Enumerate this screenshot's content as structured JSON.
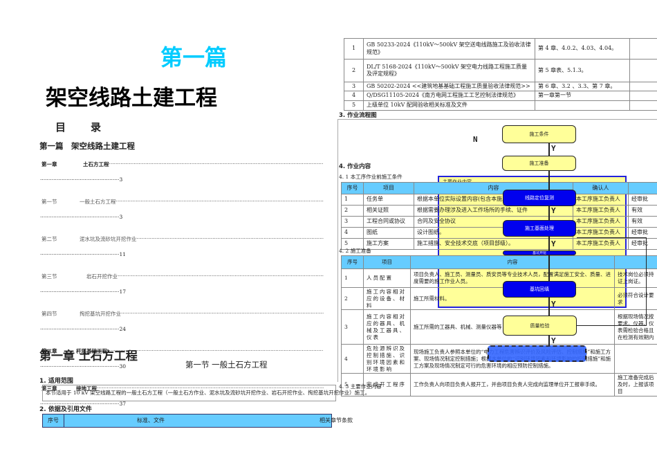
{
  "part": {
    "label": "第一篇",
    "title": "架空线路土建工程"
  },
  "toc": {
    "title": "目　　录",
    "part_heading": "第一篇　架空线路土建工程",
    "entries": [
      {
        "num": "第一章",
        "title": "土石方工程",
        "page": "3",
        "bold": true
      },
      {
        "num": "第一节",
        "title": "一般土石方工程",
        "page": "3",
        "bold": false
      },
      {
        "num": "第二节",
        "title": "泥水坑及流砂坑开挖作业",
        "page": "11",
        "bold": false
      },
      {
        "num": "第三节",
        "title": "岩石开挖作业",
        "page": "17",
        "bold": false
      },
      {
        "num": "第四节",
        "title": "掏挖基坑开挖作业",
        "page": "24",
        "bold": false
      },
      {
        "num": "第二章",
        "title": "杆塔基础工程",
        "page": "30",
        "bold": true
      },
      {
        "num": "第三章",
        "title": "接地工程",
        "page": "37",
        "bold": true
      }
    ]
  },
  "chapter": {
    "title": "第一章 土石方工程",
    "section": "第一节 一般土石方工程"
  },
  "scope": {
    "heading": "1. 适用范围",
    "text": "本节适用于 10 kV 架空线路工程的一般土石方工程（一般土石方作业、泥水坑及流砂坑开挖作业、岩石开挖作业、掏挖基坑开挖作业）施工。"
  },
  "refs": {
    "heading": "2. 依据及引用文件",
    "headers": [
      "序号",
      "标准、文件",
      "相关章节条款"
    ],
    "rows": [
      [
        "1",
        "GB 50233-2024《110kV～500kV 架空送电线路施工及验收法律规范》",
        "第 4 章、4.0.2、4.03、4.04。"
      ],
      [
        "2",
        "DL/T 5168-2024《110kV～500kV 架空电力线路工程施工质量及评定规程》",
        "第 5 章表、5.1.3。"
      ],
      [
        "3",
        "GB 50202-2024 <<建筑地基基础工程施工质量验收法律规范>>",
        "第 6 章、3.2 、3.3、第 7 章。"
      ],
      [
        "4",
        "Q/DSG11105-2024《南方电网工程施工工艺控制法律规范》",
        "第一章第一节"
      ],
      [
        "5",
        "上级单位 10kV 配网验收相关标准及文件",
        ""
      ]
    ]
  },
  "flow": {
    "heading": "3. 作业流程图",
    "n_label": "N",
    "y_label": "Y",
    "main_label": "主要作业内容",
    "steps": [
      "施工条件",
      "施工准备",
      "线路定位复测",
      "施工基面处理",
      "基坑开挖",
      "基坑回填",
      "质量检验"
    ]
  },
  "work": {
    "heading": "4. 作业内容",
    "cond": {
      "heading": "4. 1 本工序作业前施工条件",
      "headers": [
        "序号",
        "项目",
        "内容",
        "确认人",
        ""
      ],
      "rows": [
        [
          "1",
          "任务单",
          "根据本单位实际设置内容(包含本施工作业任务)",
          "本工序施工负责人",
          "经审批"
        ],
        [
          "2",
          "相关证照",
          "根据需要办理涉及进入工作场所的手续、证件",
          "本工序施工负责人",
          "有效"
        ],
        [
          "3",
          "工程合同或协议",
          "合同及安全协议",
          "本工序施工负责人",
          "有效"
        ],
        [
          "4",
          "图纸",
          "设计图纸。",
          "本工序施工负责人",
          "经审批"
        ],
        [
          "5",
          "施工方案",
          "施工措施、安全技术交底（项目部级）。",
          "本工序施工负责人",
          "经审批"
        ]
      ]
    },
    "prep": {
      "heading": "4. 2 施工准备",
      "headers": [
        "序号",
        "项目",
        "内容",
        ""
      ],
      "rows": [
        [
          "1",
          "人员配置",
          "项目负责人、施工员、测量员、质安员等专业技术人员，配置满足施工安全、质量、进度需要的施工作业人员。",
          "技术岗位必须持证上岗证。"
        ],
        [
          "2",
          "施工内容相对应的设备、材料",
          "施工所需材料。",
          "必须符合设计要求"
        ],
        [
          "3",
          "施工内容相对应的器具、机械及工器具、仪表",
          "施工所需的工器具、机械、测量仪器等",
          "根据现场情况按要求。仪器、仪表需检验合格且在检测有效期内"
        ],
        [
          "4",
          "危险源辨识及控制措施、识别环境因素和环境影响",
          "现场施工负责人参照本单位的“电力工程危害辨识评价及风险评估、控制措施”和施工方案、现场情况制定控制措施；根据本单位的“识别环境因素和环境影响的控制措施”和施工方案及现场情况制定可行的危害环境的相应预防控制措施。",
          ""
        ],
        [
          "5",
          "完成开工程序",
          "工作负责人向项目负责人报开工，并由项目负责人完成向监理单位开工报审手续。",
          "施工准备完成后及时，上报该项目"
        ]
      ]
    },
    "main_heading": "4. 3 主要作业内容"
  },
  "colors": {
    "title_cyan": "#00ccff",
    "header_blue": "#66ccff",
    "step_yellow": "#ffff99",
    "step_blue": "#0000ee",
    "frame_blue": "#2222dd"
  }
}
